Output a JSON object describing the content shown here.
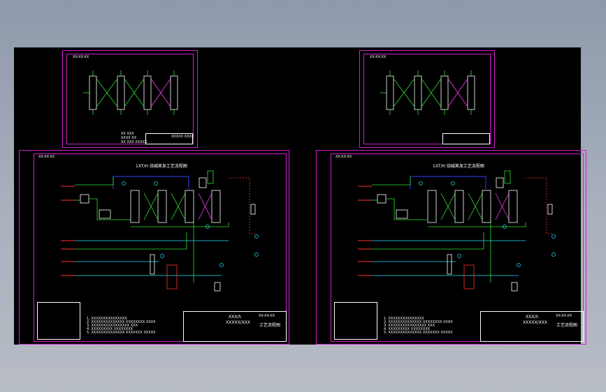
{
  "small_sheets": [
    {
      "code": "XX-XX-XX",
      "note_lines": [
        "XX XXX",
        "XXXX XX",
        "XX XXX XXXXX"
      ],
      "tb_title": "XXXXX XXXX"
    },
    {
      "code": "XX-XX-XX",
      "note_lines": [],
      "tb_title": ""
    }
  ],
  "large_sheets": [
    {
      "code": "XX-XX-XX",
      "title": "1XT/H 烧碱蒸发工艺流程图",
      "tb_main": "XXX/h",
      "tb_sub": "XXXXX/XXX",
      "tb_name": "工艺流程图",
      "tb_code": "XX-XX-XX",
      "notes": [
        "1. XXXXXXXXXXXXXXX",
        "2. XXXXXXXXXXXXXX XXXXXXXX XXXX",
        "3. XXXXXXXXXXXXXXXX XXX",
        "4. XXXXXXXXX XXXXXXXX",
        "5. XXXXXXXXXXXXXX XXXXXXX XXXXX"
      ]
    },
    {
      "code": "XX-XX-XX",
      "title": "1XT/H 烧碱蒸发工艺流程图",
      "tb_main": "XXX/h",
      "tb_sub": "XXXXX/XXX",
      "tb_name": "工艺流程图",
      "tb_code": "XX-XX-XX",
      "notes": [
        "1. XXXXXXXXXXXXXXX",
        "2. XXXXXXXXXXXXXX XXXXXXXX XXXX",
        "3. XXXXXXXXXXXXXXXX XXX",
        "4. XXXXXXXXX XXXXXXXX",
        "5. XXXXXXXXXXXXXX XXXXXXX XXXXX"
      ]
    }
  ],
  "colors": {
    "background": "#000000",
    "frame": "#d020d0",
    "line_green": "#30e030",
    "line_blue": "#3040ff",
    "line_cyan": "#20e0ff",
    "line_red": "#ff3030",
    "line_magenta": "#ff40ff",
    "text": "#ffffff"
  }
}
